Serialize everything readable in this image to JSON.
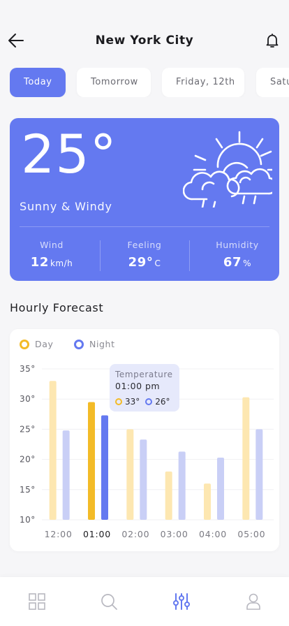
{
  "header": {
    "title": "New York City",
    "back_icon": "arrow-left-icon",
    "notification_icon": "bell-icon"
  },
  "tabs": [
    {
      "label": "Today",
      "active": true
    },
    {
      "label": "Tomorrow",
      "active": false
    },
    {
      "label": "Friday, 12th",
      "active": false
    },
    {
      "label": "Saturday",
      "active": false
    }
  ],
  "current": {
    "temperature": "25°",
    "condition": "Sunny & Windy",
    "icon": "sun-behind-clouds-icon",
    "stats": [
      {
        "label": "Wind",
        "value": "12",
        "unit": "km/h"
      },
      {
        "label": "Feeling",
        "value": "29°",
        "unit": "C"
      },
      {
        "label": "Humidity",
        "value": "67",
        "unit": "%"
      }
    ]
  },
  "hourly": {
    "section_title": "Hourly Forecast",
    "legend": {
      "day": "Day",
      "night": "Night"
    },
    "tooltip": {
      "title": "Temperature",
      "time": "01:00 pm",
      "day_value": "33°",
      "night_value": "26°"
    }
  },
  "colors": {
    "accent": "#6479f0",
    "day": "#f3bb27",
    "day_light": "#fde7b1",
    "night_light": "#c9cff6"
  },
  "chart_data": {
    "type": "bar",
    "categories": [
      "12:00",
      "01:00",
      "02:00",
      "03:00",
      "04:00",
      "05:00"
    ],
    "selected_category": "01:00",
    "series": [
      {
        "name": "Day",
        "values": [
          33,
          29.5,
          25,
          18,
          16,
          30.3
        ]
      },
      {
        "name": "Night",
        "values": [
          24.8,
          27.3,
          23.3,
          21.3,
          20.3,
          25
        ]
      }
    ],
    "y_ticks": [
      "35°",
      "30°",
      "25°",
      "20°",
      "15°",
      "10°"
    ],
    "ylim": [
      10,
      35
    ],
    "grid": true,
    "legend_position": "top-left"
  },
  "bottom_nav": [
    {
      "icon": "grid-icon",
      "active": false
    },
    {
      "icon": "search-icon",
      "active": false
    },
    {
      "icon": "sliders-icon",
      "active": true
    },
    {
      "icon": "user-icon",
      "active": false
    }
  ]
}
